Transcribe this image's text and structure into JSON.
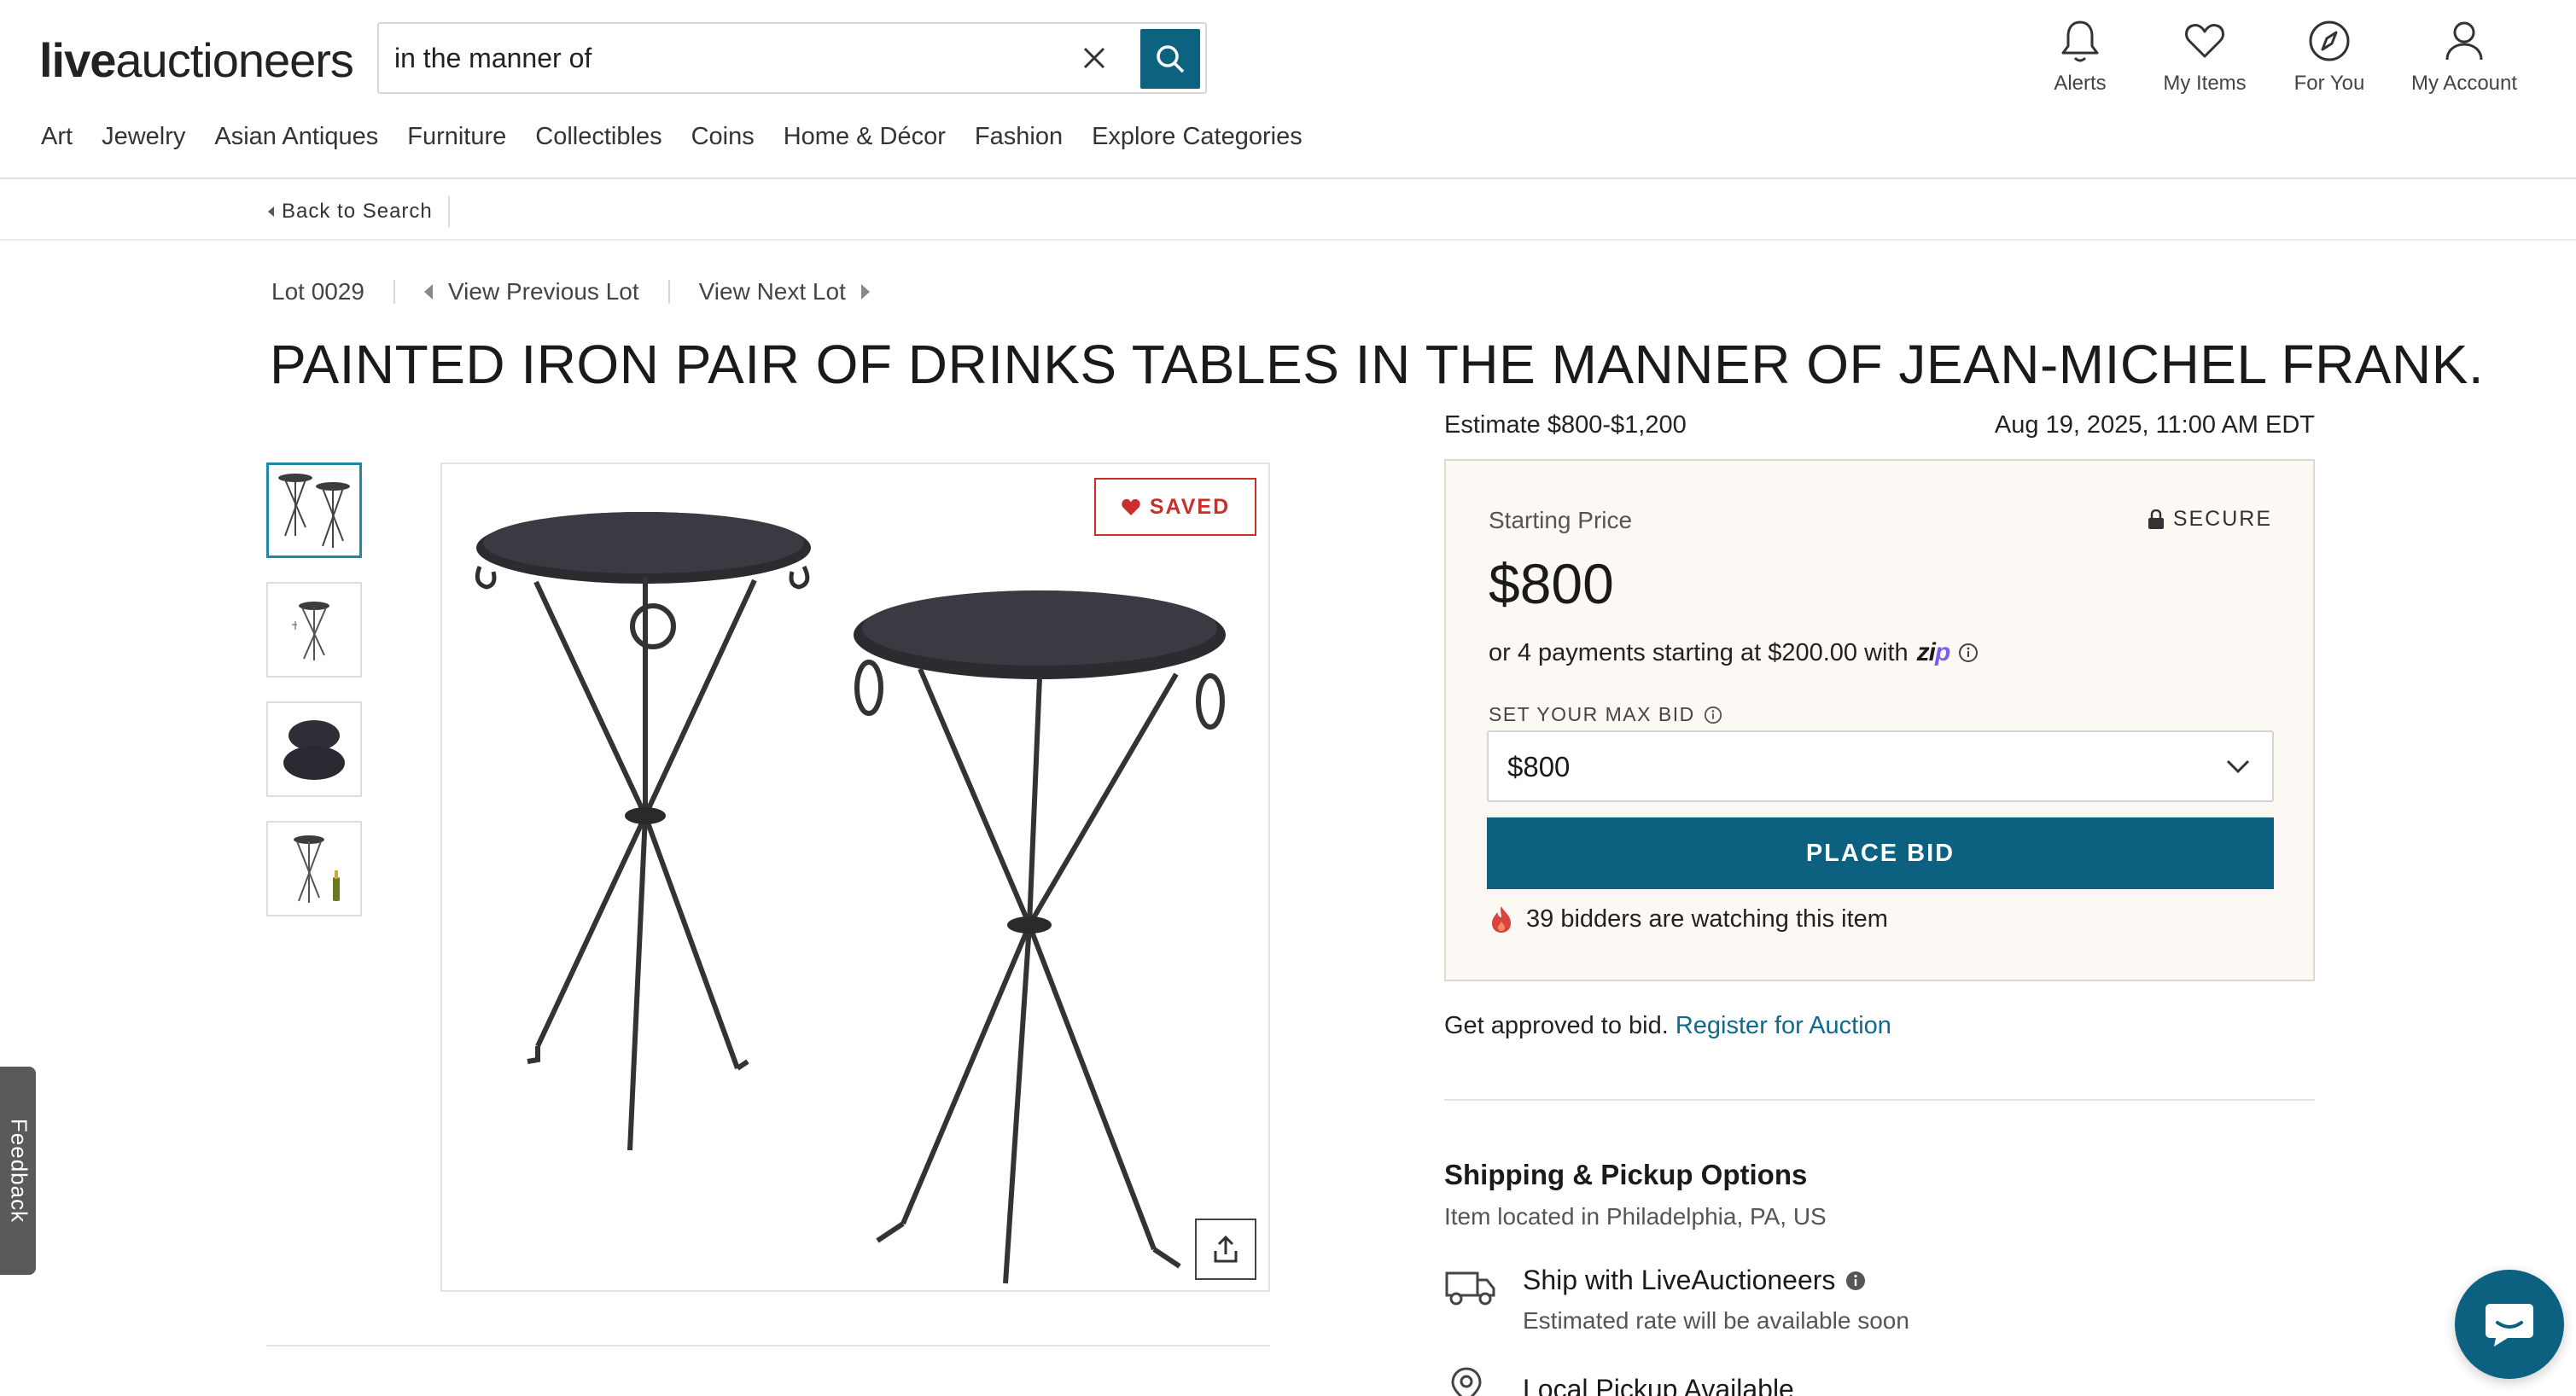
{
  "header": {
    "logo_bold": "live",
    "logo_light": "auctioneers",
    "search": {
      "value": "in the manner of",
      "placeholder": ""
    },
    "icons": [
      {
        "label": "Alerts",
        "icon": "bell-icon"
      },
      {
        "label": "My Items",
        "icon": "heart-icon"
      },
      {
        "label": "For You",
        "icon": "compass-icon"
      },
      {
        "label": "My Account",
        "icon": "user-icon"
      }
    ],
    "categories": [
      "Art",
      "Jewelry",
      "Asian Antiques",
      "Furniture",
      "Collectibles",
      "Coins",
      "Home & Décor",
      "Fashion",
      "Explore Categories"
    ]
  },
  "subbar": {
    "back_label": "Back to Search"
  },
  "lot_nav": {
    "lot": "Lot 0029",
    "prev": "View Previous Lot",
    "next": "View Next Lot"
  },
  "title": "PAINTED IRON PAIR OF DRINKS TABLES IN THE MANNER OF JEAN-MICHEL FRANK.",
  "gallery": {
    "saved_label": "SAVED",
    "thumb_count": 4,
    "active_thumb": 1
  },
  "auction": {
    "estimate": "Estimate $800-$1,200",
    "date": "Aug 19, 2025, 11:00 AM EDT"
  },
  "bid_panel": {
    "starting_label": "Starting Price",
    "secure_label": "SECURE",
    "price": "$800",
    "payments_text": "or 4 payments starting at $200.00 with",
    "zip_brand_a": "zi",
    "zip_brand_b": "p",
    "max_bid_label": "SET YOUR MAX BID",
    "max_bid_value": "$800",
    "place_bid_label": "PLACE BID",
    "watching_text": "39 bidders are watching this item",
    "accent": "#0c6080",
    "panel_bg": "#fcf8f4"
  },
  "register": {
    "text": "Get approved to bid.",
    "link": "Register for Auction"
  },
  "shipping": {
    "title": "Shipping & Pickup Options",
    "location": "Item located in Philadelphia, PA, US",
    "ship_title": "Ship with LiveAuctioneers",
    "ship_sub": "Estimated rate will be available soon",
    "pickup_title": "Local Pickup Available"
  },
  "floating": {
    "feedback": "Feedback"
  }
}
